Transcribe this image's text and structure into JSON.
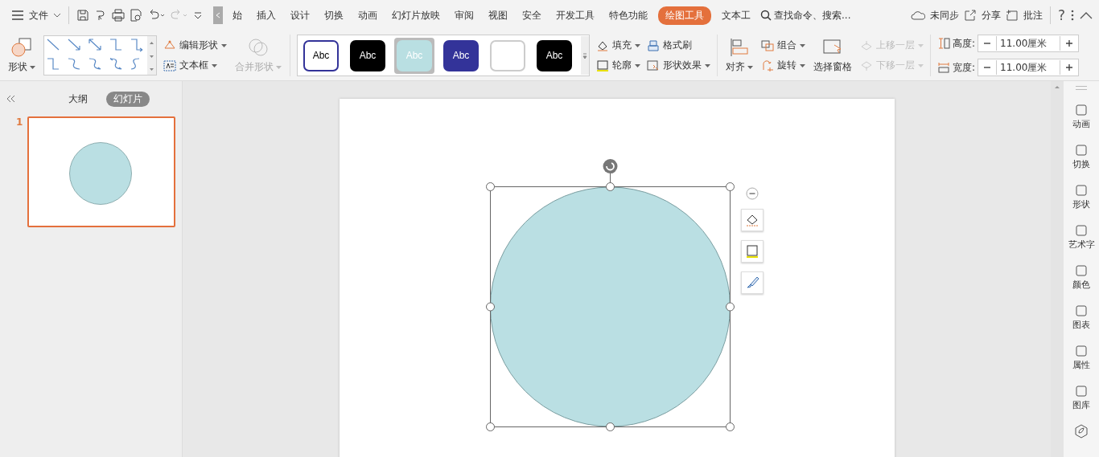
{
  "menu": {
    "file_label": "文件",
    "tabs": [
      {
        "label": "始",
        "selected": false
      },
      {
        "label": "插入",
        "selected": false
      },
      {
        "label": "设计",
        "selected": false
      },
      {
        "label": "切换",
        "selected": false
      },
      {
        "label": "动画",
        "selected": false
      },
      {
        "label": "幻灯片放映",
        "selected": false
      },
      {
        "label": "审阅",
        "selected": false
      },
      {
        "label": "视图",
        "selected": false
      },
      {
        "label": "安全",
        "selected": false
      },
      {
        "label": "开发工具",
        "selected": false
      },
      {
        "label": "特色功能",
        "selected": false
      },
      {
        "label": "绘图工具",
        "selected": true
      },
      {
        "label": "文本工",
        "selected": false
      }
    ],
    "search": {
      "placeholder": "查找命令、搜索..."
    },
    "sync": "未同步",
    "share": "分享",
    "comment": "批注",
    "help": "?"
  },
  "ribbon": {
    "shape": "形状",
    "edit_shape": "编辑形状",
    "textbox": "文本框",
    "merge": {
      "label": "合并形状",
      "disabled": true
    },
    "styles": [
      {
        "label": "Abc",
        "color": "#ffffff",
        "selected": false
      },
      {
        "label": "Abc",
        "color": "#000000",
        "selected": false
      },
      {
        "label": "Abc",
        "color": "#b9dfe2",
        "selected": true
      },
      {
        "label": "Abc",
        "color": "#333399",
        "selected": false
      },
      {
        "color": "#ffffff",
        "selected": false
      },
      {
        "label": "Abc",
        "color": "#000000",
        "selected": false
      }
    ],
    "fill": "填充",
    "format_painter": "格式刷",
    "outline": "轮廓",
    "effects": "形状效果",
    "align": "对齐",
    "group": "组合",
    "rotate": "旋转",
    "selection_pane": "选择窗格",
    "bring_forward": {
      "label": "上移一层",
      "disabled": true
    },
    "send_backward": {
      "label": "下移一层",
      "disabled": true
    },
    "height": {
      "label": "高度:",
      "value": "11.00厘米"
    },
    "width": {
      "label": "宽度:",
      "value": "11.00厘米"
    }
  },
  "left_panel": {
    "tabs": [
      {
        "label": "大纲",
        "selected": false
      },
      {
        "label": "幻灯片",
        "selected": true
      }
    ],
    "slides": [
      {
        "number": "1",
        "selected": true
      }
    ]
  },
  "right_sidebar": {
    "items": [
      {
        "label": "动画"
      },
      {
        "label": "切换"
      },
      {
        "label": "形状"
      },
      {
        "label": "艺术字"
      },
      {
        "label": "颜色"
      },
      {
        "label": "图表"
      },
      {
        "label": "属性"
      },
      {
        "label": "图库"
      }
    ]
  }
}
